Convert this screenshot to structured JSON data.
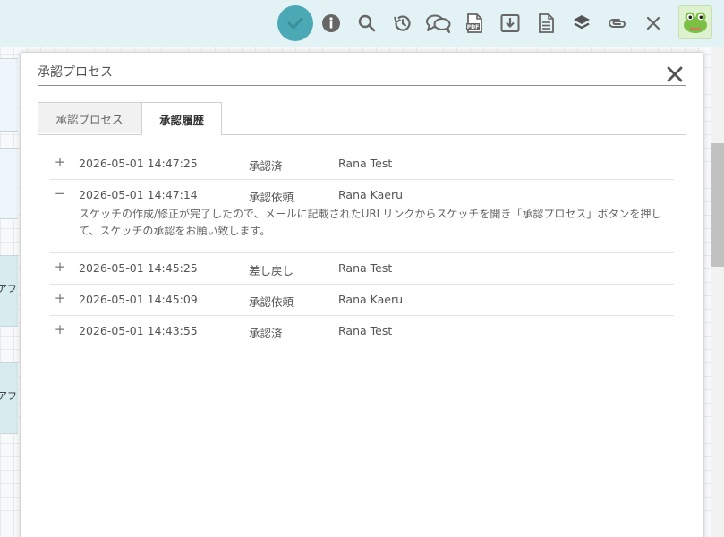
{
  "toolbar": {
    "buttons": [
      {
        "name": "approve-check-icon"
      },
      {
        "name": "info-icon"
      },
      {
        "name": "search-icon"
      },
      {
        "name": "history-icon"
      },
      {
        "name": "comments-icon"
      },
      {
        "name": "pdf-icon"
      },
      {
        "name": "download-icon"
      },
      {
        "name": "document-icon"
      },
      {
        "name": "layers-icon"
      },
      {
        "name": "paperclip-icon"
      },
      {
        "name": "close-icon"
      }
    ],
    "avatar": "frog-avatar-icon",
    "accent": "#4aa9b5"
  },
  "background": {
    "card_labels": [
      "アフ",
      "アフ"
    ]
  },
  "dialog": {
    "title": "承認プロセス",
    "tabs": [
      {
        "label": "承認プロセス",
        "active": false
      },
      {
        "label": "承認履歴",
        "active": true
      }
    ],
    "history": [
      {
        "toggle": "+",
        "datetime": "2026-05-01 14:47:25",
        "status": "承認済",
        "user": "Rana Test",
        "expanded": false
      },
      {
        "toggle": "−",
        "datetime": "2026-05-01 14:47:14",
        "status": "承認依頼",
        "user": "Rana Kaeru",
        "expanded": true,
        "comment": "スケッチの作成/修正が完了したので、メールに記載されたURLリンクからスケッチを開き「承認プロセス」ボタンを押して、スケッチの承認をお願い致します。"
      },
      {
        "toggle": "+",
        "datetime": "2026-05-01 14:45:25",
        "status": "差し戻し",
        "user": "Rana Test",
        "expanded": false
      },
      {
        "toggle": "+",
        "datetime": "2026-05-01 14:45:09",
        "status": "承認依頼",
        "user": "Rana Kaeru",
        "expanded": false
      },
      {
        "toggle": "+",
        "datetime": "2026-05-01 14:43:55",
        "status": "承認済",
        "user": "Rana Test",
        "expanded": false
      }
    ]
  }
}
